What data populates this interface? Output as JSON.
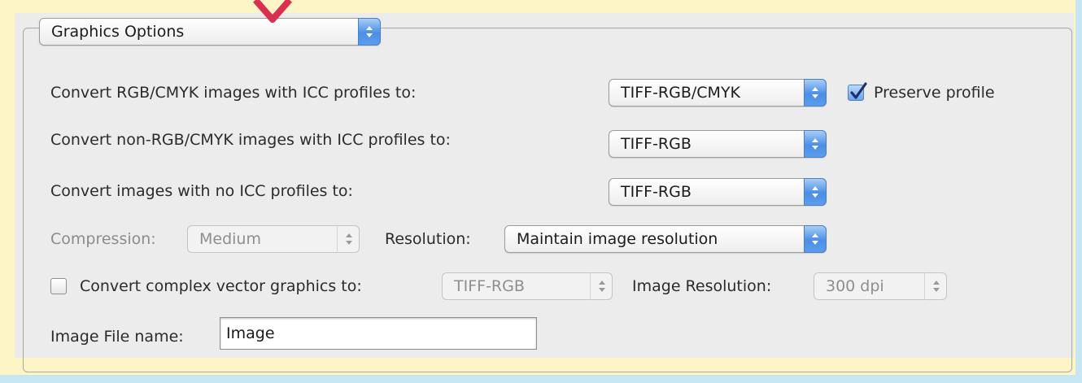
{
  "section_popup": {
    "value": "Graphics Options"
  },
  "rows": {
    "rgb_cmyk": {
      "label": "Convert RGB/CMYK images with ICC profiles to:",
      "value": "TIFF-RGB/CMYK"
    },
    "preserve_profile": {
      "label": "Preserve profile",
      "checked": true
    },
    "non_rgb_cmyk": {
      "label": "Convert non-RGB/CMYK images with ICC profiles to:",
      "value": "TIFF-RGB"
    },
    "no_icc": {
      "label": "Convert images with no ICC profiles to:",
      "value": "TIFF-RGB"
    },
    "compression": {
      "label": "Compression:",
      "value": "Medium",
      "enabled": false
    },
    "resolution": {
      "label": "Resolution:",
      "value": "Maintain image resolution"
    },
    "complex_vector": {
      "label": "Convert complex vector graphics to:",
      "checked": false,
      "value": "TIFF-RGB"
    },
    "image_resolution": {
      "label": "Image Resolution:",
      "value": "300 dpi"
    },
    "image_file_name": {
      "label": "Image File name:",
      "value": "Image"
    }
  },
  "colors": {
    "highlight_background": "#fdf5c6",
    "frame": "#c6e6f3",
    "arrow": "#d9304f",
    "popup_accent": "#4a8ee6"
  },
  "icons": {
    "popup_arrows": "up-down-chevrons-icon",
    "annotation": "down-arrow-icon",
    "check": "checkmark-icon"
  }
}
